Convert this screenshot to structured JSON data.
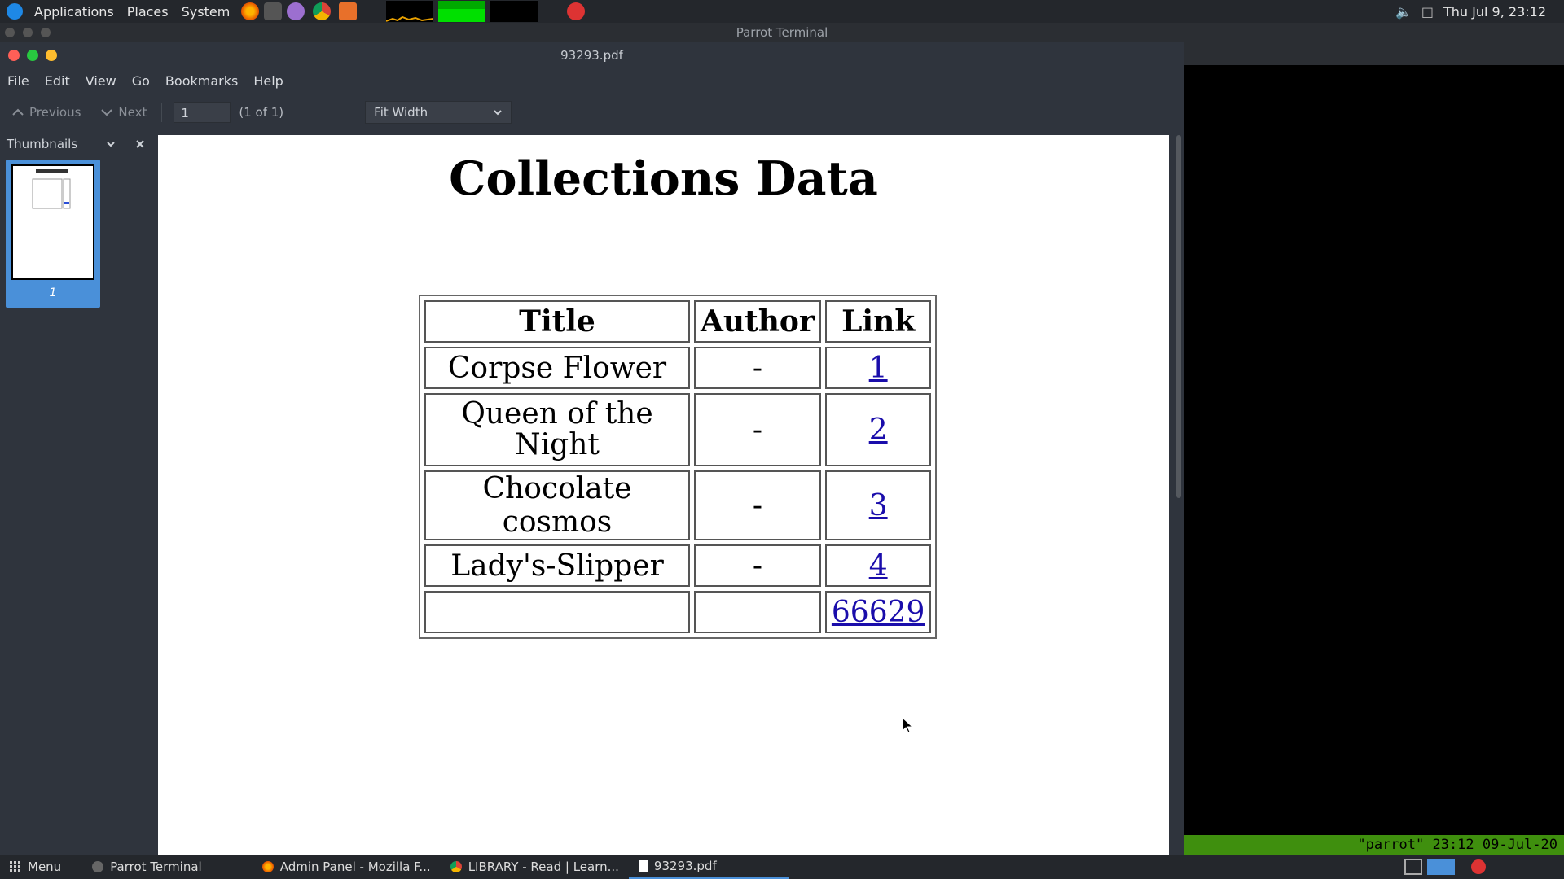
{
  "topbar": {
    "menus": [
      "Applications",
      "Places",
      "System"
    ],
    "clock": "Thu Jul 9, 23:12"
  },
  "terminal": {
    "title": "Parrot Terminal",
    "status": "\"parrot\" 23:12 09-Jul-20"
  },
  "pdf": {
    "window_title": "93293.pdf",
    "menu": [
      "File",
      "Edit",
      "View",
      "Go",
      "Bookmarks",
      "Help"
    ],
    "toolbar": {
      "previous": "Previous",
      "next": "Next",
      "page_value": "1",
      "page_of": "(1 of 1)",
      "zoom": "Fit Width"
    },
    "sidebar": {
      "title": "Thumbnails",
      "thumb_label": "1"
    },
    "document": {
      "title": "Collections Data",
      "headers": [
        "Title",
        "Author",
        "Link"
      ],
      "rows": [
        {
          "title": "Corpse Flower",
          "author": "-",
          "link": "1"
        },
        {
          "title": "Queen of the Night",
          "author": "-",
          "link": "2"
        },
        {
          "title": "Chocolate cosmos",
          "author": "-",
          "link": "3"
        },
        {
          "title": "Lady's-Slipper",
          "author": "-",
          "link": "4"
        },
        {
          "title": "",
          "author": "",
          "link": "66629"
        }
      ]
    }
  },
  "taskbar": {
    "menu": "Menu",
    "tasks": [
      {
        "label": "Parrot Terminal"
      },
      {
        "label": "Admin Panel - Mozilla F..."
      },
      {
        "label": "LIBRARY - Read | Learn..."
      },
      {
        "label": "93293.pdf"
      }
    ]
  }
}
